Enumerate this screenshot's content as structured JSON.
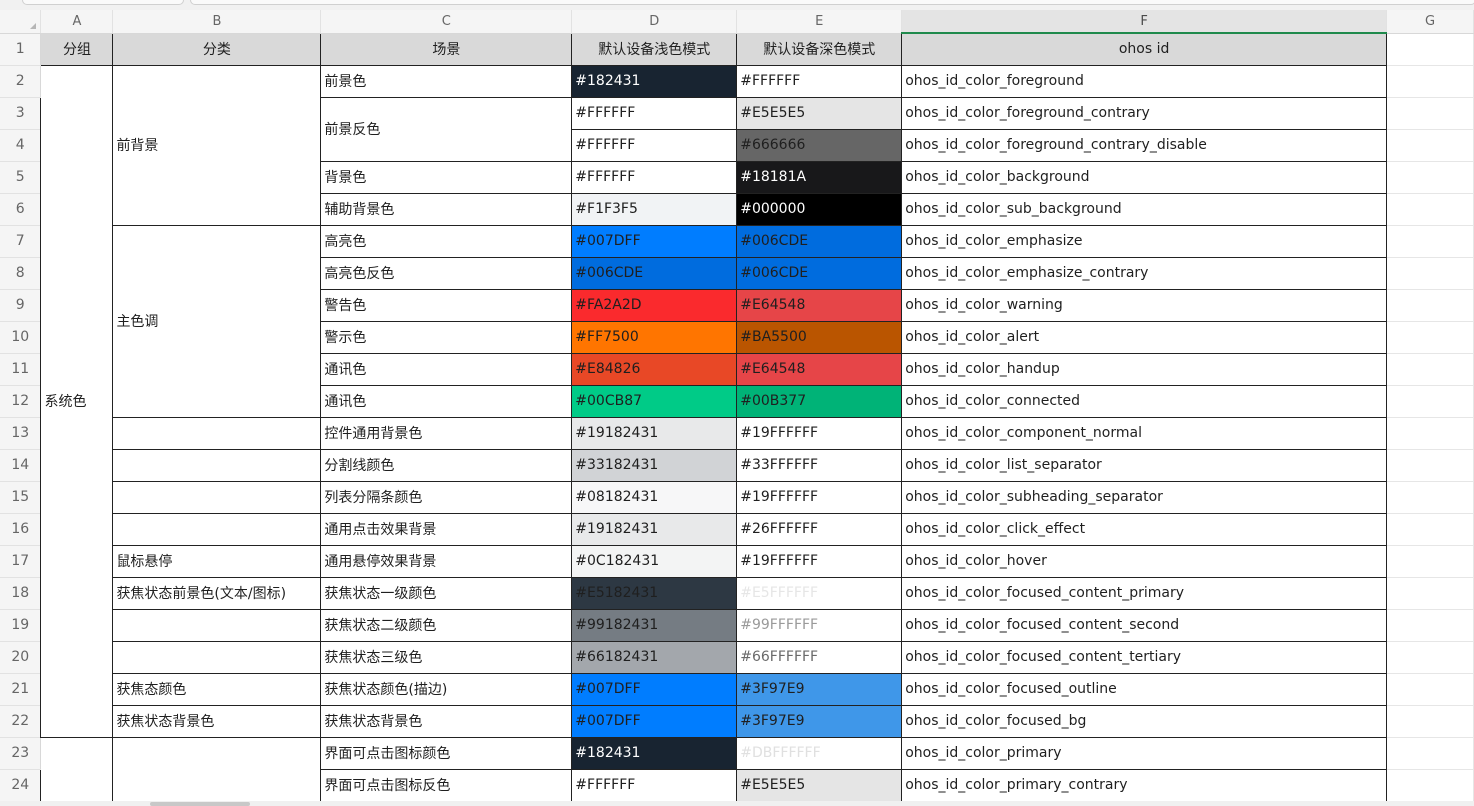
{
  "columns": [
    "A",
    "B",
    "C",
    "D",
    "E",
    "F",
    "G"
  ],
  "header": {
    "group": "分组",
    "category": "分类",
    "scene": "场景",
    "light": "默认设备浅色模式",
    "dark": "默认设备深色模式",
    "id": "ohos id"
  },
  "groups": {
    "system": "系统色"
  },
  "categories": {
    "fg_bg": "前背景",
    "main": "主色调",
    "hover": "鼠标悬停",
    "focus_fg": "获焦状态前景色(文本/图标)",
    "focus_color": "获焦态颜色",
    "focus_bg": "获焦状态背景色"
  },
  "rows": [
    {
      "num": "1"
    },
    {
      "num": "2",
      "scene": "前景色",
      "light": "#182431",
      "light_bg": "#182431",
      "light_fg": "#ffffff",
      "dark": "#FFFFFF",
      "dark_bg": "#ffffff",
      "dark_fg": "#1f1f1f",
      "id": "ohos_id_color_foreground"
    },
    {
      "num": "3",
      "scene": "前景反色",
      "light": "#FFFFFF",
      "light_bg": "#ffffff",
      "light_fg": "#1f1f1f",
      "dark": "#E5E5E5",
      "dark_bg": "#e5e5e5",
      "dark_fg": "#1f1f1f",
      "id": "ohos_id_color_foreground_contrary"
    },
    {
      "num": "4",
      "light": "#FFFFFF",
      "light_bg": "#ffffff",
      "light_fg": "#1f1f1f",
      "dark": "#666666",
      "dark_bg": "#666666",
      "dark_fg": "#1f1f1f",
      "id": "ohos_id_color_foreground_contrary_disable"
    },
    {
      "num": "5",
      "scene": "背景色",
      "light": "#FFFFFF",
      "light_bg": "#ffffff",
      "light_fg": "#1f1f1f",
      "dark": "#18181A",
      "dark_bg": "#18181a",
      "dark_fg": "#ffffff",
      "id": "ohos_id_color_background"
    },
    {
      "num": "6",
      "scene": "辅助背景色",
      "light": "#F1F3F5",
      "light_bg": "#f1f3f5",
      "light_fg": "#1f1f1f",
      "dark": "#000000",
      "dark_bg": "#000000",
      "dark_fg": "#ffffff",
      "id": "ohos_id_color_sub_background"
    },
    {
      "num": "7",
      "scene": "高亮色",
      "light": "#007DFF",
      "light_bg": "#007dff",
      "light_fg": "#1f1f1f",
      "dark": "#006CDE",
      "dark_bg": "#006cde",
      "dark_fg": "#1f1f1f",
      "id": "ohos_id_color_emphasize"
    },
    {
      "num": "8",
      "scene": "高亮色反色",
      "light": "#006CDE",
      "light_bg": "#006cde",
      "light_fg": "#1f1f1f",
      "dark": "#006CDE",
      "dark_bg": "#006cde",
      "dark_fg": "#1f1f1f",
      "id": "ohos_id_color_emphasize_contrary"
    },
    {
      "num": "9",
      "scene": "警告色",
      "light": "#FA2A2D",
      "light_bg": "#fa2a2d",
      "light_fg": "#1f1f1f",
      "dark": "#E64548",
      "dark_bg": "#e64548",
      "dark_fg": "#1f1f1f",
      "id": "ohos_id_color_warning"
    },
    {
      "num": "10",
      "scene": "警示色",
      "light": "#FF7500",
      "light_bg": "#ff7500",
      "light_fg": "#1f1f1f",
      "dark": "#BA5500",
      "dark_bg": "#ba5500",
      "dark_fg": "#1f1f1f",
      "id": "ohos_id_color_alert"
    },
    {
      "num": "11",
      "scene": "通讯色",
      "light": "#E84826",
      "light_bg": "#e84826",
      "light_fg": "#1f1f1f",
      "dark": "#E64548",
      "dark_bg": "#e64548",
      "dark_fg": "#1f1f1f",
      "id": "ohos_id_color_handup"
    },
    {
      "num": "12",
      "scene": "通讯色",
      "light": "#00CB87",
      "light_bg": "#00cb87",
      "light_fg": "#1f1f1f",
      "dark": "#00B377",
      "dark_bg": "#00b377",
      "dark_fg": "#1f1f1f",
      "id": "ohos_id_color_connected"
    },
    {
      "num": "13",
      "scene": "控件通用背景色",
      "light": "#19182431",
      "light_bg": "#e8e9ea",
      "light_fg": "#1f1f1f",
      "dark": "#19FFFFFF",
      "dark_bg": "#ffffff",
      "dark_fg": "#1f1f1f",
      "id": "ohos_id_color_component_normal"
    },
    {
      "num": "14",
      "scene": "分割线颜色",
      "light": "#33182431",
      "light_bg": "#d1d3d6",
      "light_fg": "#1f1f1f",
      "dark": "#33FFFFFF",
      "dark_bg": "#ffffff",
      "dark_fg": "#1f1f1f",
      "id": "ohos_id_color_list_separator"
    },
    {
      "num": "15",
      "scene": "列表分隔条颜色",
      "light": "#08182431",
      "light_bg": "#f7f7f8",
      "light_fg": "#1f1f1f",
      "dark": "#19FFFFFF",
      "dark_bg": "#ffffff",
      "dark_fg": "#1f1f1f",
      "id": "ohos_id_color_subheading_separator"
    },
    {
      "num": "16",
      "scene": "通用点击效果背景",
      "light": "#19182431",
      "light_bg": "#e8e9ea",
      "light_fg": "#1f1f1f",
      "dark": "#26FFFFFF",
      "dark_bg": "#ffffff",
      "dark_fg": "#1f1f1f",
      "id": "ohos_id_color_click_effect"
    },
    {
      "num": "17",
      "scene": "通用悬停效果背景",
      "light": "#0C182431",
      "light_bg": "#f3f4f4",
      "light_fg": "#1f1f1f",
      "dark": "#19FFFFFF",
      "dark_bg": "#ffffff",
      "dark_fg": "#1f1f1f",
      "id": "ohos_id_color_hover"
    },
    {
      "num": "18",
      "scene": "获焦状态一级颜色",
      "light": "#E5182431",
      "light_bg": "#2d3843",
      "light_fg": "#1f1f1f",
      "dark": "#E5FFFFFF",
      "dark_bg": "#ffffff",
      "dark_fg": "#e6e6e6",
      "id": "ohos_id_color_focused_content_primary"
    },
    {
      "num": "19",
      "scene": "获焦状态二级颜色",
      "light": "#99182431",
      "light_bg": "#757c83",
      "light_fg": "#1f1f1f",
      "dark": "#99FFFFFF",
      "dark_bg": "#ffffff",
      "dark_fg": "#9a9a9a",
      "id": "ohos_id_color_focused_content_second"
    },
    {
      "num": "20",
      "scene": "获焦状态三级色",
      "light": "#66182431",
      "light_bg": "#a3a7ac",
      "light_fg": "#1f1f1f",
      "dark": "#66FFFFFF",
      "dark_bg": "#ffffff",
      "dark_fg": "#6a6a6a",
      "id": "ohos_id_color_focused_content_tertiary"
    },
    {
      "num": "21",
      "scene": "获焦状态颜色(描边)",
      "light": "#007DFF",
      "light_bg": "#007dff",
      "light_fg": "#1f1f1f",
      "dark": "#3F97E9",
      "dark_bg": "#3f97e9",
      "dark_fg": "#1f1f1f",
      "id": "ohos_id_color_focused_outline"
    },
    {
      "num": "22",
      "scene": "获焦状态背景色",
      "light": "#007DFF",
      "light_bg": "#007dff",
      "light_fg": "#1f1f1f",
      "dark": "#3F97E9",
      "dark_bg": "#3f97e9",
      "dark_fg": "#1f1f1f",
      "id": "ohos_id_color_focused_bg"
    },
    {
      "num": "23",
      "scene": "界面可点击图标颜色",
      "light": "#182431",
      "light_bg": "#182431",
      "light_fg": "#ffffff",
      "dark": "#DBFFFFFF",
      "dark_bg": "#ffffff",
      "dark_fg": "#e0e0e0",
      "id": "ohos_id_color_primary"
    },
    {
      "num": "24",
      "scene": "界面可点击图标反色",
      "light": "#FFFFFF",
      "light_bg": "#ffffff",
      "light_fg": "#1f1f1f",
      "dark": "#E5E5E5",
      "dark_bg": "#e5e5e5",
      "dark_fg": "#1f1f1f",
      "id": "ohos_id_color_primary_contrary"
    }
  ]
}
